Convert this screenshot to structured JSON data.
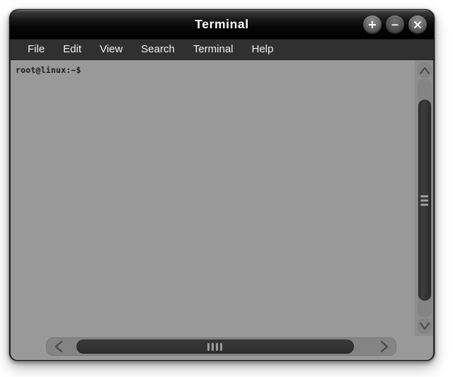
{
  "window": {
    "title": "Terminal",
    "controls": [
      {
        "name": "maximize-button",
        "icon": "plus-icon",
        "label": "+"
      },
      {
        "name": "minimize-button",
        "icon": "minus-icon",
        "label": "−"
      },
      {
        "name": "close-button",
        "icon": "close-icon",
        "label": "✕"
      }
    ]
  },
  "menubar": {
    "items": [
      {
        "label": "File"
      },
      {
        "label": "Edit"
      },
      {
        "label": "View"
      },
      {
        "label": "Search"
      },
      {
        "label": "Terminal"
      },
      {
        "label": "Help"
      }
    ]
  },
  "terminal": {
    "prompt": "root@linux:~$",
    "lines": [
      "root@linux:~$"
    ],
    "background_color": "#999999",
    "text_color": "#1c1c1c"
  },
  "scrollbars": {
    "vertical": {
      "up_arrow": "∧",
      "down_arrow": "∨",
      "grip_lines": 3
    },
    "horizontal": {
      "left_arrow": "<",
      "right_arrow": ">",
      "grip_lines": 4
    }
  },
  "colors": {
    "titlebar": "#000000",
    "menubar": "#303030",
    "terminal_bg": "#999999",
    "scroll_trough": "#848484",
    "scroll_thumb": "#343434",
    "desktop": "#ffffff"
  }
}
